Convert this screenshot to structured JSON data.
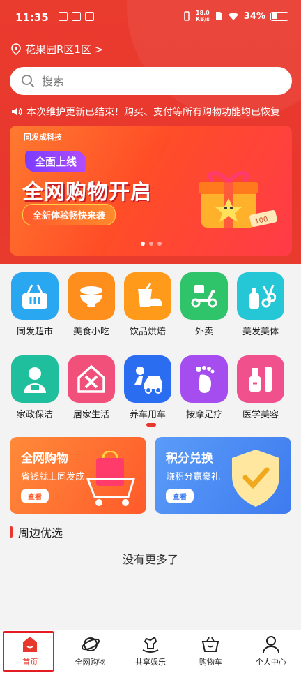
{
  "status_bar": {
    "time": "11:35",
    "speed_value": "18.0",
    "speed_unit": "KB/s",
    "battery": "34%"
  },
  "location": {
    "label": "花果园R区1区 >"
  },
  "search": {
    "placeholder": "搜索"
  },
  "notice": {
    "text": "本次维护更新已结束！购买、支付等所有购物功能均已恢复"
  },
  "banner": {
    "brand": "同发成科技",
    "tag": "全面上线",
    "title": "全网购物开启",
    "subtitle": "全新体验畅快来袭",
    "gift_number": "100"
  },
  "categories": [
    {
      "label": "同发超市",
      "icon": "basket-icon",
      "color": "#29a7f0"
    },
    {
      "label": "美食小吃",
      "icon": "bowl-icon",
      "color": "#ff8f1c"
    },
    {
      "label": "饮品烘焙",
      "icon": "drink-icon",
      "color": "#ff9a1a"
    },
    {
      "label": "外卖",
      "icon": "scooter-icon",
      "color": "#2fc46a"
    },
    {
      "label": "美发美体",
      "icon": "scissors-icon",
      "color": "#25c6d6"
    },
    {
      "label": "家政保洁",
      "icon": "housekeeper-icon",
      "color": "#1fbe9c"
    },
    {
      "label": "居家生活",
      "icon": "home-tools-icon",
      "color": "#f0507a"
    },
    {
      "label": "养车用车",
      "icon": "car-repair-icon",
      "color": "#2a6df0"
    },
    {
      "label": "按摩足疗",
      "icon": "foot-icon",
      "color": "#a64df0"
    },
    {
      "label": "医学美容",
      "icon": "cosmetics-icon",
      "color": "#f0508c"
    }
  ],
  "promos": [
    {
      "title": "全网购物",
      "subtitle": "省钱就上同发成",
      "button": "查看",
      "color": "#ff7a2f"
    },
    {
      "title": "积分兑换",
      "subtitle": "赚积分赢豪礼",
      "button": "查看",
      "color": "#4c8cf5"
    }
  ],
  "section": {
    "title": "周边优选"
  },
  "empty": {
    "text": "没有更多了"
  },
  "tabs": [
    {
      "label": "首页",
      "icon": "home-icon",
      "active": true
    },
    {
      "label": "全网购物",
      "icon": "planet-icon",
      "active": false
    },
    {
      "label": "共享娱乐",
      "icon": "rocking-horse-icon",
      "active": false
    },
    {
      "label": "购物车",
      "icon": "cart-icon",
      "active": false
    },
    {
      "label": "个人中心",
      "icon": "person-icon",
      "active": false
    }
  ],
  "colors": {
    "brand": "#e8382d",
    "tab_active": "#e8382d",
    "highlight": "#e31b23"
  }
}
